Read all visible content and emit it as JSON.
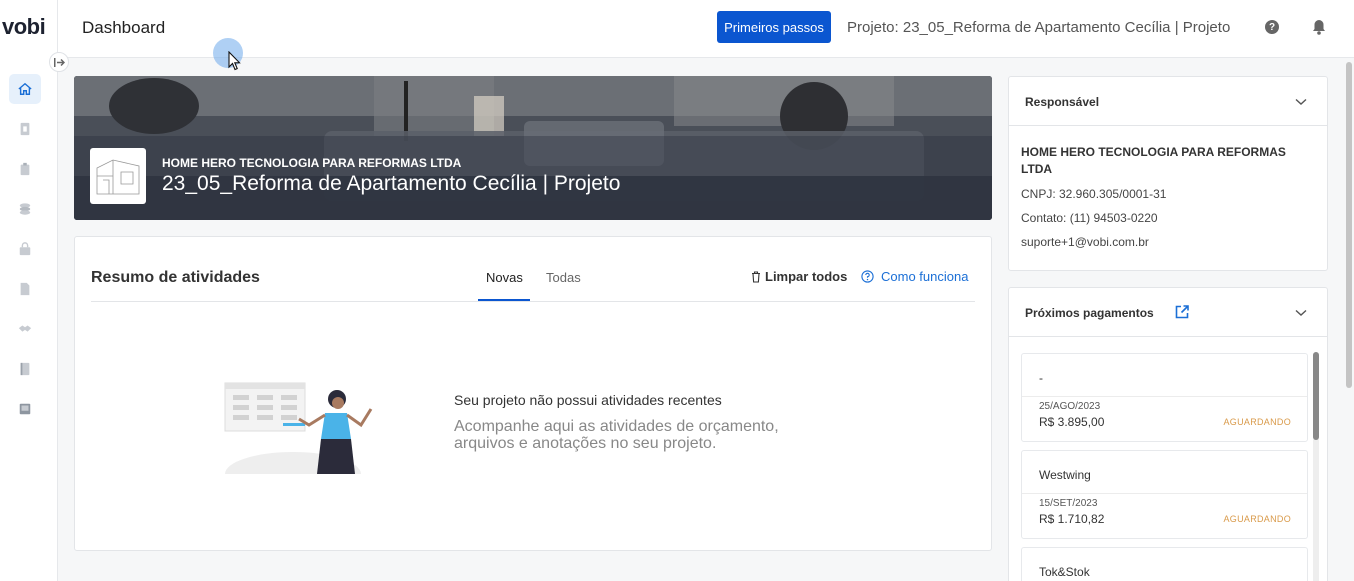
{
  "sidebar": {
    "logo": "vobi",
    "items": [
      {
        "icon": "home-icon"
      },
      {
        "icon": "document-money-icon"
      },
      {
        "icon": "clipboard-icon"
      },
      {
        "icon": "coins-icon"
      },
      {
        "icon": "shopping-bag-icon"
      },
      {
        "icon": "file-icon"
      },
      {
        "icon": "handshake-icon"
      },
      {
        "icon": "notebook-icon"
      },
      {
        "icon": "book-icon"
      }
    ]
  },
  "header": {
    "title": "Dashboard",
    "primary_button": "Primeiros passos",
    "project": "Projeto: 23_05_Reforma de Apartamento Cecília | Projeto"
  },
  "banner": {
    "company": "HOME HERO TECNOLOGIA PARA REFORMAS LTDA",
    "title": "23_05_Reforma de Apartamento Cecília | Projeto"
  },
  "activities": {
    "title": "Resumo de atividades",
    "tabs": [
      "Novas",
      "Todas"
    ],
    "clear_all": "Limpar todos",
    "how_it_works": "Como funciona",
    "empty_title": "Seu projeto não possui atividades recentes",
    "empty_description": "Acompanhe aqui as atividades de orçamento, arquivos e anotações no seu projeto."
  },
  "responsible": {
    "title": "Responsável",
    "company": "HOME HERO TECNOLOGIA PARA REFORMAS LTDA",
    "cnpj": "CNPJ: 32.960.305/0001-31",
    "contact": "Contato: (11) 94503-0220",
    "email": "suporte+1@vobi.com.br"
  },
  "payments": {
    "title": "Próximos pagamentos",
    "items": [
      {
        "name": "-",
        "date": "25/AGO/2023",
        "amount": "R$ 3.895,00",
        "status": "AGUARDANDO"
      },
      {
        "name": "Westwing",
        "date": "15/SET/2023",
        "amount": "R$ 1.710,82",
        "status": "AGUARDANDO"
      },
      {
        "name": "Tok&Stok",
        "date": "",
        "amount": "",
        "status": ""
      }
    ]
  },
  "colors": {
    "primary": "#0b56d0",
    "link": "#1b6fd6",
    "status_waiting": "#d99a4a",
    "active_nav_bg": "#e6f0fb"
  }
}
